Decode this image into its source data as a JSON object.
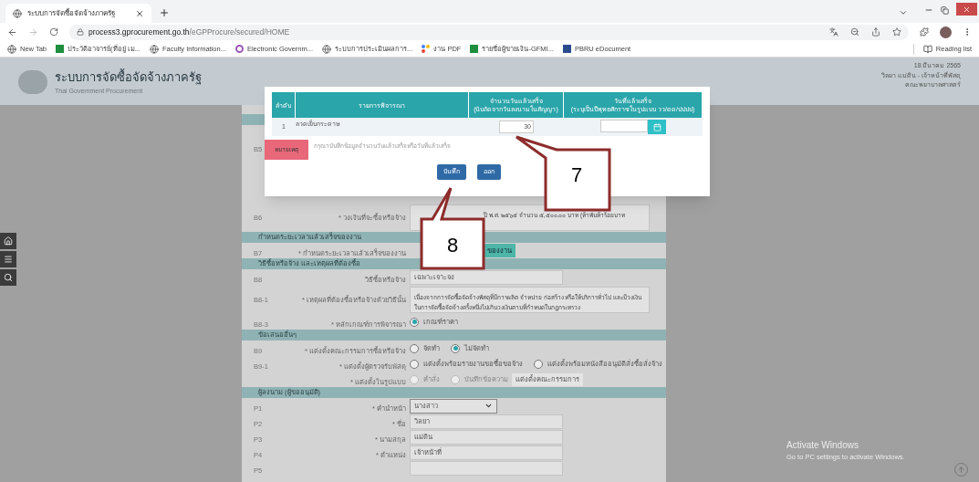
{
  "browser": {
    "tab": {
      "title": "ระบบการจัดซื้อจัดจ้างภาครัฐ",
      "selected": true
    },
    "url_host": "process3.gprocurement.go.th",
    "url_path": "/eGPProcure/secured/HOME",
    "bookmarks": [
      {
        "kind": "globe",
        "label": "New Tab"
      },
      {
        "kind": "sheet",
        "label": "ประวัติอาจารย์(ที่อยู่ เม..."
      },
      {
        "kind": "globe",
        "label": "Faculty Information..."
      },
      {
        "kind": "logo",
        "label": "Electronic Governm..."
      },
      {
        "kind": "globe",
        "label": "ระบบการประเมินผลการ..."
      },
      {
        "kind": "dots",
        "label": "งาน PDF"
      },
      {
        "kind": "sheet",
        "label": "รายชื่อผู้ขายเงิน-GFMI..."
      },
      {
        "kind": "doc",
        "label": "PBRU eDocument"
      }
    ],
    "reading_list": "Reading list"
  },
  "header": {
    "title": "ระบบการจัดซื้อจัดจ้างภาครัฐ",
    "subtitle": "Thai Government Procurement",
    "date": "18 มีนาคม 2565",
    "user": "วิลยา แม่ดิน - เจ้าหน้าที่พัสดุ",
    "unit": "คณะพยาบาลศาสตร์"
  },
  "form": [
    {
      "kind": "field",
      "code": "B5",
      "control": {
        "kind": "hidden"
      }
    },
    {
      "kind": "field",
      "code": "B6",
      "label": "* วงเงินที่จะซื้อหรือจ้าง",
      "control": {
        "kind": "textarea",
        "value": "ปี พ.ศ. ๒๕๖๕ จำนวน ๕,๕๐๐.๐๐ บาท (ห้าพันห้าร้อยบาท",
        "indent": true
      }
    },
    {
      "kind": "section",
      "title": "กำหนดระยะเวลาแล้วเสร็จของงาน"
    },
    {
      "kind": "field",
      "code": "B7",
      "label": "* กำหนดระยะเวลาแล้วเสร็จของงาน",
      "control": {
        "kind": "button",
        "label": "ของงาน"
      }
    },
    {
      "kind": "section",
      "title": "วิธีซื้อหรือจ้าง และเหตุผลที่ต้องซื้อ"
    },
    {
      "kind": "field",
      "code": "B8",
      "label": "วิธีซื้อหรือจ้าง",
      "control": {
        "kind": "text",
        "value": "เฉพาะเจาะจง"
      }
    },
    {
      "kind": "field",
      "code": "B8-1",
      "label": "* เหตุผลที่ต้องซื้อหรือจ้างด้วยวิธีนั้น",
      "control": {
        "kind": "textarea",
        "value": "เนื่องจากการจัดซื้อจัดจ้างพัสดุที่มีการผลิต จำหน่าย ก่อสร้าง หรือให้บริการทั่วไป และมีวงเงินในการจัดซื้อจัดจ้างครั้งหนึ่งไม่เกินวงเงินตามที่กำหนดในกฎกระทรวง"
      }
    },
    {
      "kind": "field",
      "code": "B8-3",
      "label": "* หลักเกณฑ์การพิจารณา",
      "control": {
        "kind": "radio",
        "disabled": false,
        "options": [
          {
            "label": "เกณฑ์ราคา",
            "selected": true
          }
        ]
      }
    },
    {
      "kind": "section",
      "title": "ข้อเสนออื่นๆ"
    },
    {
      "kind": "field",
      "code": "B9",
      "label": "* แต่งตั้งคณะกรรมการซื้อหรือจ้าง",
      "control": {
        "kind": "radio",
        "disabled": false,
        "options": [
          {
            "label": "จัดทำ",
            "selected": false
          },
          {
            "label": "ไม่จัดทำ",
            "selected": true
          }
        ]
      }
    },
    {
      "kind": "field",
      "code": "B9-1",
      "label": "* แต่งตั้งผู้ตรวจรับพัสดุ",
      "control": {
        "kind": "radio",
        "disabled": false,
        "options": [
          {
            "label": "แต่งตั้งพร้อมรายงานขอซื้อขอจ้าง",
            "selected": false
          },
          {
            "label": "แต่งตั้งพร้อมหนังสืออนุมัติสั่งซื้อสั่งจ้าง",
            "selected": false
          }
        ]
      }
    },
    {
      "kind": "field",
      "label": "* แต่งตั้งในรูปแบบ",
      "control": {
        "kind": "radio",
        "disabled": true,
        "options": [
          {
            "label": "คำสั่ง",
            "selected": false
          },
          {
            "label": "บันทึกข้อความ",
            "selected": false
          }
        ],
        "button": "แต่งตั้งคณะกรรมการ"
      }
    },
    {
      "kind": "section",
      "title": "ผู้ลงนาม (ผู้ขออนุมัติ)"
    },
    {
      "kind": "field",
      "code": "P1",
      "label": "* คำนำหน้า",
      "control": {
        "kind": "select",
        "value": "นางสาว"
      }
    },
    {
      "kind": "field",
      "code": "P2",
      "label": "* ชื่อ",
      "control": {
        "kind": "text",
        "value": "วิลยา"
      }
    },
    {
      "kind": "field",
      "code": "P3",
      "label": "* นามสกุล",
      "control": {
        "kind": "text",
        "value": "แม่ดิน"
      }
    },
    {
      "kind": "field",
      "code": "P4",
      "label": "* ตำแหน่ง",
      "control": {
        "kind": "text",
        "value": "เจ้าหน้าที่"
      }
    },
    {
      "kind": "field",
      "code": "P5",
      "control": {
        "kind": "text"
      }
    }
  ],
  "modal": {
    "columns": [
      {
        "title": "ลำดับ"
      },
      {
        "title": "รายการพิจารณา"
      },
      {
        "title": "จำนวนวันแล้วเสร็จ",
        "subtitle": "(นับถัดจากวันลงนามในสัญญา)"
      },
      {
        "title": "วันที่แล้วเสร็จ",
        "subtitle": "(ระบุเป็นปีพุทธศักราชในรูปแบบ วว/ดด/ปปปป)"
      }
    ],
    "rows": [
      {
        "index": "1",
        "item": "ลวดเย็บกระดาษ",
        "days": "30"
      }
    ],
    "note_badge": "หมายเหตุ",
    "note": "กรุณาบันทึกข้อมูลจำนวนวันแล้วเสร็จหรือวันที่แล้วเสร็จ",
    "buttons": [
      {
        "label": "บันทึก"
      },
      {
        "label": "ออก"
      }
    ]
  },
  "callouts": [
    {
      "number": "7"
    },
    {
      "number": "8"
    }
  ],
  "os_notice": {
    "title": "Activate Windows",
    "text": "Go to PC settings to activate Windows."
  }
}
